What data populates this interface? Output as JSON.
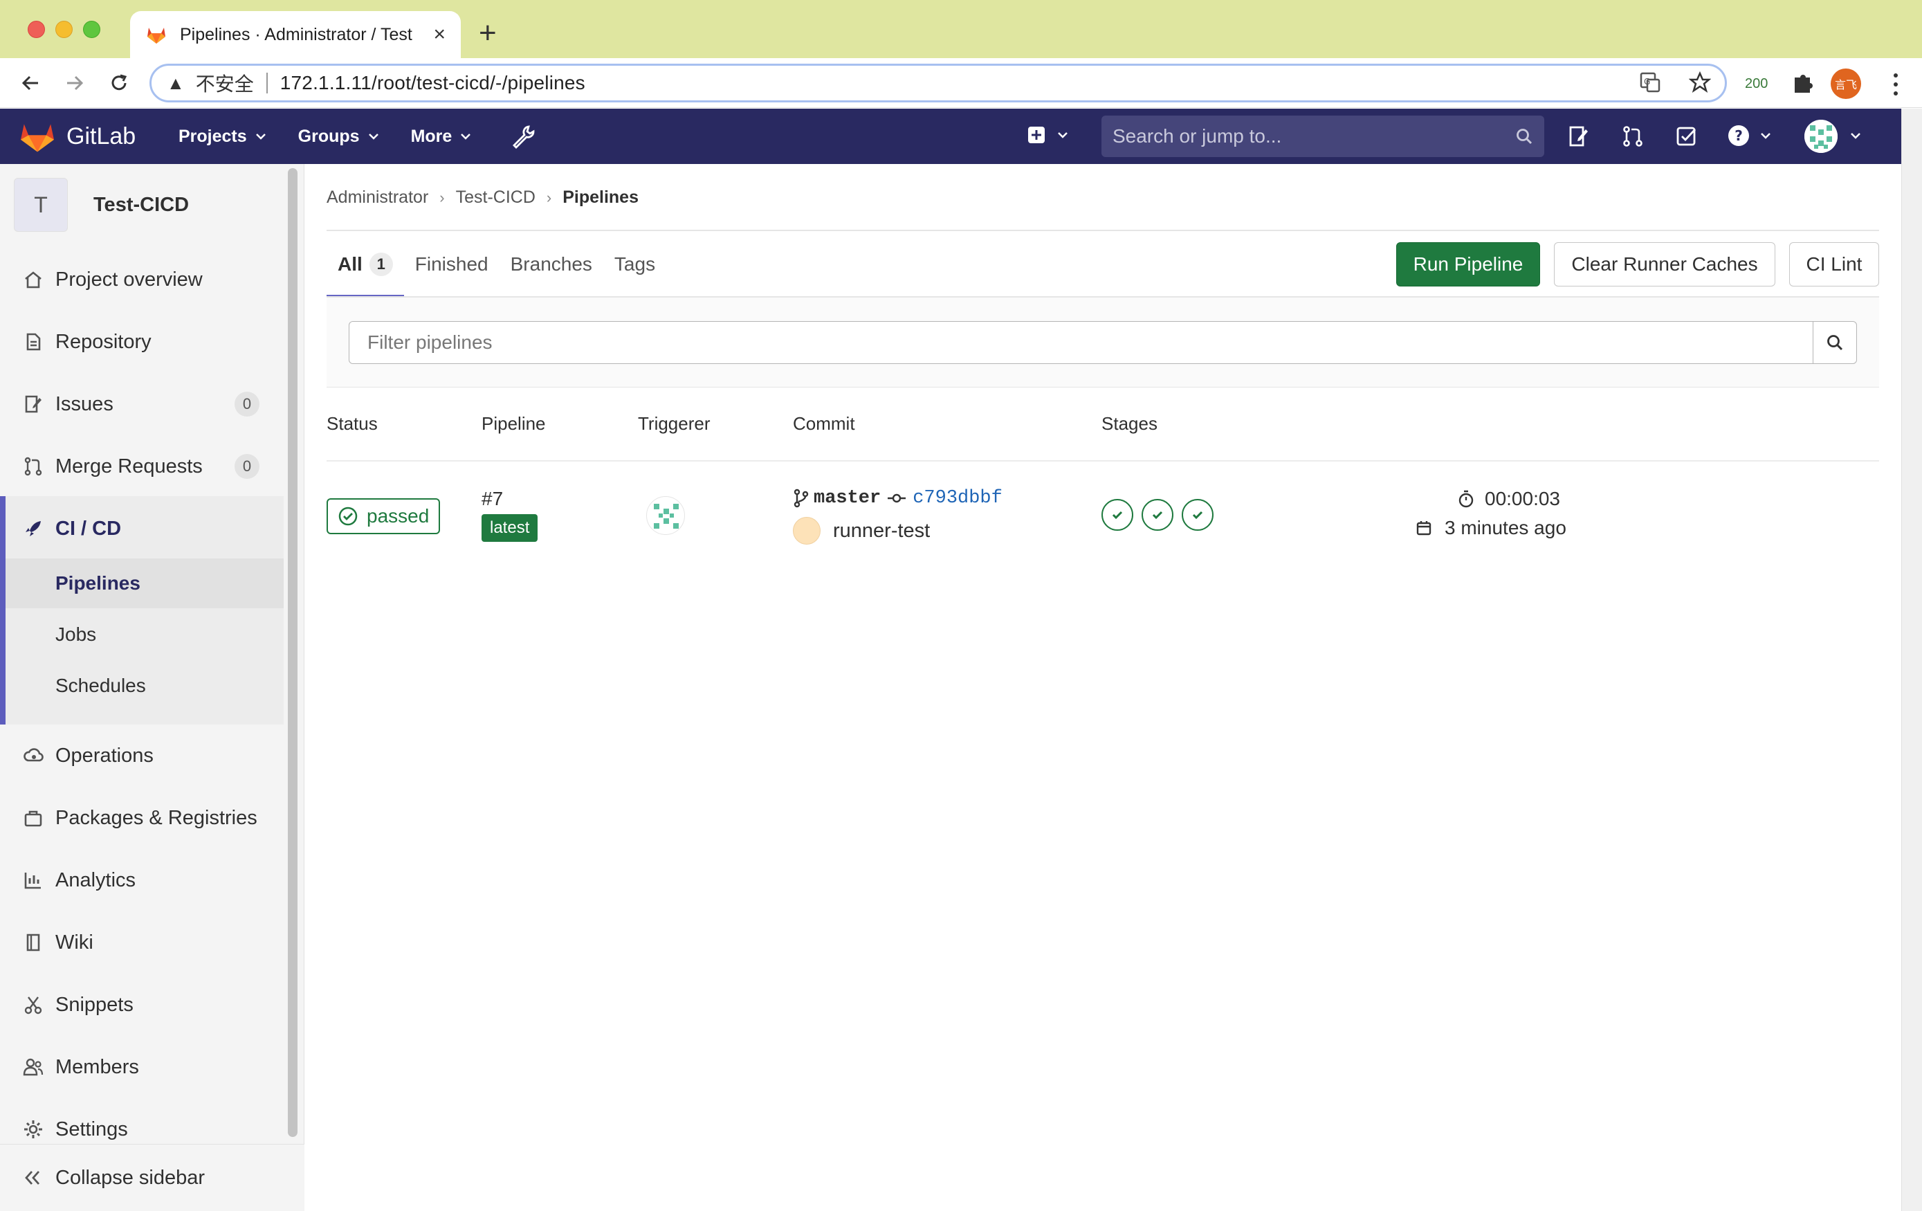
{
  "browser": {
    "tab_title": "Pipelines · Administrator / Test",
    "new_tab": "+",
    "insecure_label": "不安全",
    "url": "172.1.1.11/root/test-cicd/-/pipelines",
    "extension_count": "200",
    "profile_label": "言飞"
  },
  "header": {
    "brand": "GitLab",
    "nav": [
      {
        "label": "Projects"
      },
      {
        "label": "Groups"
      },
      {
        "label": "More"
      }
    ],
    "search_placeholder": "Search or jump to..."
  },
  "sidebar": {
    "project_initial": "T",
    "project_name": "Test-CICD",
    "items": [
      {
        "label": "Project overview",
        "icon": "home-icon"
      },
      {
        "label": "Repository",
        "icon": "document-icon"
      },
      {
        "label": "Issues",
        "icon": "issues-icon",
        "count": "0"
      },
      {
        "label": "Merge Requests",
        "icon": "merge-request-icon",
        "count": "0"
      },
      {
        "label": "CI / CD",
        "icon": "rocket-icon"
      },
      {
        "label": "Operations",
        "icon": "cloud-gear-icon"
      },
      {
        "label": "Packages & Registries",
        "icon": "package-icon"
      },
      {
        "label": "Analytics",
        "icon": "chart-icon"
      },
      {
        "label": "Wiki",
        "icon": "book-icon"
      },
      {
        "label": "Snippets",
        "icon": "scissors-icon"
      },
      {
        "label": "Members",
        "icon": "users-icon"
      },
      {
        "label": "Settings",
        "icon": "gear-icon"
      }
    ],
    "ci_sub": [
      {
        "label": "Pipelines"
      },
      {
        "label": "Jobs"
      },
      {
        "label": "Schedules"
      }
    ],
    "collapse_label": "Collapse sidebar"
  },
  "breadcrumb": {
    "items": [
      "Administrator",
      "Test-CICD",
      "Pipelines"
    ]
  },
  "tabs": [
    {
      "label": "All",
      "count": "1"
    },
    {
      "label": "Finished"
    },
    {
      "label": "Branches"
    },
    {
      "label": "Tags"
    }
  ],
  "actions": {
    "run_pipeline": "Run Pipeline",
    "clear_caches": "Clear Runner Caches",
    "ci_lint": "CI Lint"
  },
  "filter": {
    "placeholder": "Filter pipelines"
  },
  "table": {
    "headers": [
      "Status",
      "Pipeline",
      "Triggerer",
      "Commit",
      "Stages"
    ],
    "rows": [
      {
        "status": "passed",
        "pipeline_id": "#7",
        "tag": "latest",
        "branch": "master",
        "sha": "c793dbbf",
        "commit_title": "runner-test",
        "duration": "00:00:03",
        "finished": "3 minutes ago",
        "stages": [
          "passed",
          "passed",
          "passed"
        ]
      }
    ]
  },
  "colors": {
    "header_bg": "#292961",
    "success": "#1f7a3f",
    "link": "#1f65b6"
  }
}
